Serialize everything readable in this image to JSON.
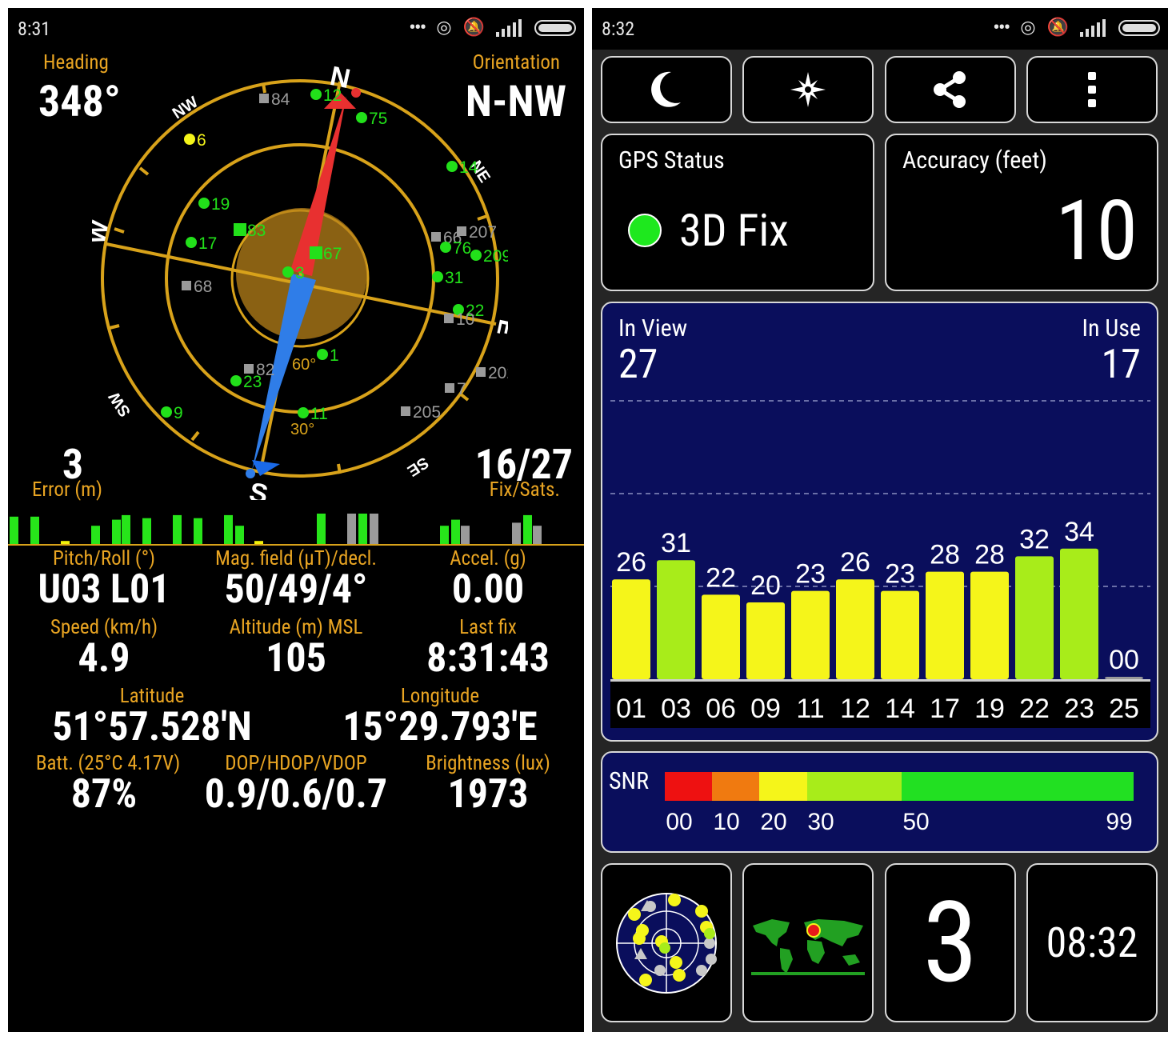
{
  "left": {
    "status": {
      "time": "8:31"
    },
    "heading": {
      "label": "Heading",
      "value": "348°"
    },
    "orientation": {
      "label": "Orientation",
      "value": "N-NW"
    },
    "compass": {
      "cardinals": {
        "n": "N",
        "s": "S",
        "e": "E",
        "w": "W",
        "nw": "NW",
        "ne": "NE",
        "se": "SE",
        "sw": "SW"
      },
      "rings": {
        "r60": "60°",
        "r30": "30°"
      },
      "satellites": [
        {
          "id": "84",
          "color": "gray"
        },
        {
          "id": "12",
          "color": "green"
        },
        {
          "id": "75",
          "color": "green"
        },
        {
          "id": "6",
          "color": "yellow"
        },
        {
          "id": "14",
          "color": "green"
        },
        {
          "id": "19",
          "color": "green"
        },
        {
          "id": "83",
          "color": "green"
        },
        {
          "id": "17",
          "color": "green"
        },
        {
          "id": "67",
          "color": "green"
        },
        {
          "id": "3",
          "color": "green"
        },
        {
          "id": "68",
          "color": "gray"
        },
        {
          "id": "66",
          "color": "gray"
        },
        {
          "id": "207",
          "color": "gray"
        },
        {
          "id": "76",
          "color": "green"
        },
        {
          "id": "209",
          "color": "green"
        },
        {
          "id": "31",
          "color": "green"
        },
        {
          "id": "22",
          "color": "green"
        },
        {
          "id": "10",
          "color": "gray"
        },
        {
          "id": "82",
          "color": "gray"
        },
        {
          "id": "23",
          "color": "green"
        },
        {
          "id": "1",
          "color": "green"
        },
        {
          "id": "7",
          "color": "gray"
        },
        {
          "id": "202",
          "color": "gray"
        },
        {
          "id": "9",
          "color": "green"
        },
        {
          "id": "11",
          "color": "green"
        },
        {
          "id": "205",
          "color": "gray"
        }
      ]
    },
    "error": {
      "value": "3",
      "label": "Error (m)"
    },
    "fixsats": {
      "value": "16/27",
      "label": "Fix/Sats."
    },
    "mini_bars": [
      {
        "v": 0.9,
        "c": "#27e51a"
      },
      {
        "v": 0.9,
        "c": "#27e51a"
      },
      {
        "v": 0.1,
        "c": "#f2f20a"
      },
      {
        "v": 0.6,
        "c": "#27e51a"
      },
      {
        "v": 0.8,
        "c": "#27e51a"
      },
      {
        "v": 0.95,
        "c": "#27e51a"
      },
      {
        "v": 0.85,
        "c": "#27e51a"
      },
      {
        "v": 0.95,
        "c": "#27e51a"
      },
      {
        "v": 0.85,
        "c": "#27e51a"
      },
      {
        "v": 0.95,
        "c": "#27e51a"
      },
      {
        "v": 0.6,
        "c": "#27e51a"
      },
      {
        "v": 0.1,
        "c": "#f2f20a"
      },
      {
        "v": 1.0,
        "c": "#27e51a"
      },
      {
        "v": 1.0,
        "c": "#9a9a9a"
      },
      {
        "v": 1.0,
        "c": "#27e51a"
      },
      {
        "v": 1.0,
        "c": "#9a9a9a"
      },
      {
        "v": 0.6,
        "c": "#27e51a"
      },
      {
        "v": 0.8,
        "c": "#27e51a"
      },
      {
        "v": 0.6,
        "c": "#9a9a9a"
      },
      {
        "v": 0.7,
        "c": "#9a9a9a"
      },
      {
        "v": 0.95,
        "c": "#27e51a"
      },
      {
        "v": 0.6,
        "c": "#9a9a9a"
      }
    ],
    "stats": {
      "pitch_label": "Pitch/Roll (°)",
      "pitch_value": "U03 L01",
      "mag_label": "Mag. field (µT)/decl.",
      "mag_value": "50/49/4°",
      "accel_label": "Accel. (g)",
      "accel_value": "0.00",
      "speed_label": "Speed (km/h)",
      "speed_value": "4.9",
      "alt_label": "Altitude (m) MSL",
      "alt_value": "105",
      "lastfix_label": "Last fix",
      "lastfix_value": "8:31:43",
      "lat_label": "Latitude",
      "lat_value": "51°57.528'N",
      "lon_label": "Longitude",
      "lon_value": "15°29.793'E",
      "batt_label": "Batt. (25°C 4.17V)",
      "batt_value": "87%",
      "dop_label": "DOP/HDOP/VDOP",
      "dop_value": "0.9/0.6/0.7",
      "bright_label": "Brightness (lux)",
      "bright_value": "1973"
    }
  },
  "right": {
    "status": {
      "time": "8:32"
    },
    "toolbar": [
      "moon-icon",
      "compass-star-icon",
      "share-icon",
      "overflow-menu-icon"
    ],
    "gps_status": {
      "title": "GPS Status",
      "value": "3D Fix",
      "dot_color": "#1ee81e"
    },
    "accuracy": {
      "title": "Accuracy (feet)",
      "value": "10"
    },
    "sats": {
      "in_view_label": "In View",
      "in_view_value": "27",
      "in_use_label": "In Use",
      "in_use_value": "17"
    },
    "chart_data": {
      "type": "bar",
      "categories": [
        "01",
        "03",
        "06",
        "09",
        "11",
        "12",
        "14",
        "17",
        "19",
        "22",
        "23",
        "25"
      ],
      "values": [
        26,
        31,
        22,
        20,
        23,
        26,
        23,
        28,
        28,
        32,
        34,
        0
      ],
      "value_labels": [
        "26",
        "31",
        "22",
        "20",
        "23",
        "26",
        "23",
        "28",
        "28",
        "32",
        "34",
        "00"
      ],
      "colors": [
        "#f5f51a",
        "#a8ec1a",
        "#f5f51a",
        "#f5f51a",
        "#f5f51a",
        "#f5f51a",
        "#f5f51a",
        "#f5f51a",
        "#f5f51a",
        "#a8ec1a",
        "#a8ec1a",
        "#9a9a9a"
      ],
      "ylim": [
        0,
        60
      ],
      "grid": true
    },
    "snr": {
      "label": "SNR",
      "ticks": [
        "00",
        "10",
        "20",
        "30",
        "50",
        "99"
      ],
      "segments": [
        "#ee1111",
        "#f07a10",
        "#f5f51a",
        "#a8ec1a",
        "#22e022"
      ]
    },
    "bottom": {
      "count_value": "3",
      "clock_value": "08:32"
    }
  }
}
